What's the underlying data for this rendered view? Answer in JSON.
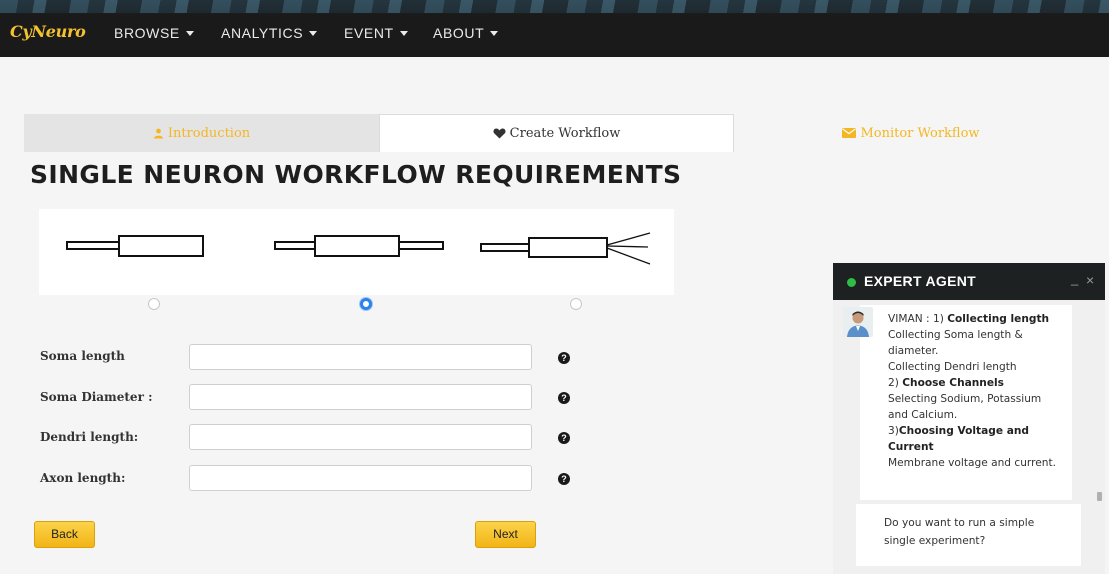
{
  "navbar": {
    "brand": "CyNeuro",
    "items": [
      "BROWSE",
      "ANALYTICS",
      "EVENT",
      "ABOUT"
    ]
  },
  "tabs": [
    {
      "label": "Introduction",
      "icon": "user-icon",
      "color": "#f3b724"
    },
    {
      "label": "Create Workflow",
      "icon": "heart-icon",
      "color": "#333333"
    },
    {
      "label": "Monitor Workflow",
      "icon": "envelope-icon",
      "color": "#f3b724"
    }
  ],
  "page_title": "SINGLE NEURON WORKFLOW REQUIREMENTS",
  "neuron_options": {
    "selected_index": 1,
    "options": [
      "soma-axon",
      "dendrite-soma-axon",
      "branched-dendrites-soma-axon"
    ]
  },
  "form": {
    "fields": [
      {
        "label": "Soma length",
        "value": ""
      },
      {
        "label": "Soma Diameter :",
        "value": ""
      },
      {
        "label": "Dendri length:",
        "value": ""
      },
      {
        "label": "Axon length:",
        "value": ""
      }
    ],
    "help_symbol": "?"
  },
  "buttons": {
    "back": "Back",
    "next": "Next"
  },
  "chat": {
    "title": "EXPERT AGENT",
    "status_color": "#2ebd45",
    "minimize": "_",
    "close": "×",
    "message": {
      "sender": "VIMAN :",
      "step1_num": "1)",
      "step1_title": "Collecting length",
      "line1": "Collecting Soma length &",
      "line2": "diameter.",
      "line3": "Collecting Dendri length",
      "step2_num": "2)",
      "step2_title": "Choose Channels",
      "line4": "Selecting Sodium, Potassium",
      "line5": "and Calcium.",
      "step3_num": "3)",
      "step3_title_a": "Choosing Voltage and",
      "step3_title_b": "Current",
      "line6": "Membrane voltage and current."
    },
    "question_a": "Do you want to run a simple",
    "question_b": "single experiment?"
  }
}
